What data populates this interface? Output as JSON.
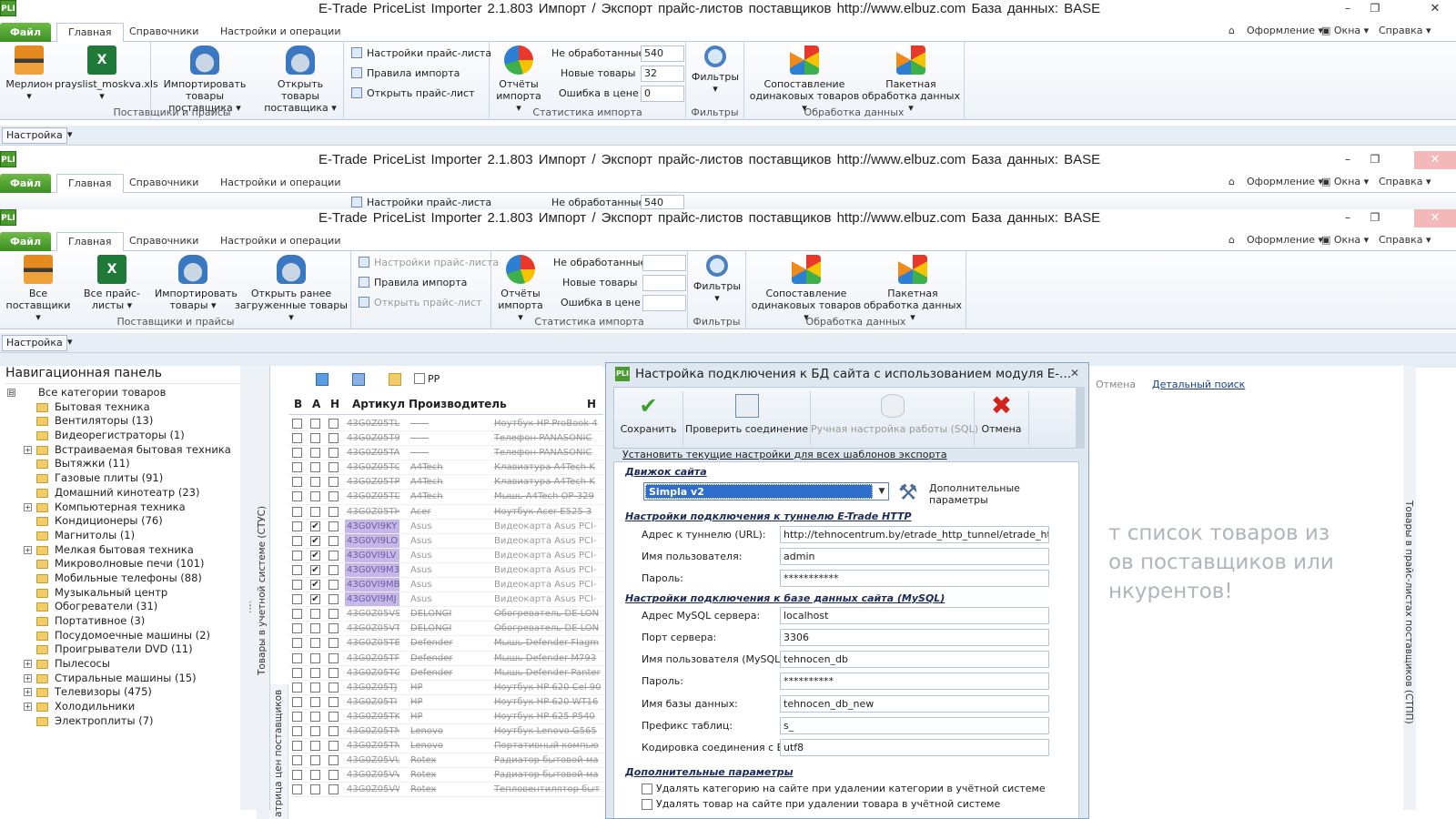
{
  "app": {
    "icon_label": "PLI",
    "title": "E-Trade PriceList Importer 2.1.803    Импорт / Экспорт прайс-листов поставщиков    http://www.elbuz.com    База данных: BASE",
    "minimize": "–",
    "restore": "❐",
    "close": "✕"
  },
  "tabs": {
    "file": "Файл",
    "home": "Главная",
    "refs": "Справочники",
    "settings_ops": "Настройки и операции",
    "appearance": "Оформление",
    "windows": "Окна",
    "help": "Справка"
  },
  "ribbon1": {
    "supplier_name": "Мерлион",
    "pricelist_file": "prayslist_moskva.xls",
    "import_goods": "Импортировать товары поставщика",
    "open_goods": "Открыть товары поставщика",
    "group_suppliers": "Поставщики и прайсы",
    "pl_settings": "Настройки прайс-листа",
    "import_rules": "Правила импорта",
    "open_pl": "Открыть прайс-лист",
    "reports": "Отчёты импорта",
    "not_processed": "Не обработанные",
    "new_goods": "Новые товары",
    "price_error": "Ошибка в цене",
    "not_processed_val": "540",
    "new_goods_val": "32",
    "price_error_val": "0",
    "group_stats": "Статистика импорта",
    "filters": "Фильтры",
    "group_filters": "Фильтры",
    "match": "Сопоставление одинаковых товаров",
    "batch": "Пакетная обработка данных",
    "group_data": "Обработка данных"
  },
  "ribbon3": {
    "all_suppliers": "Все поставщики",
    "all_pricelists": "Все прайс-листы",
    "import_goods": "Импортировать товары",
    "open_loaded": "Открыть ранее загруженные товары"
  },
  "quickbar": {
    "settings": "Настройка"
  },
  "nav": {
    "title": "Навигационная панель",
    "items": [
      {
        "label": "Все категории товаров",
        "exp": "⊟",
        "root": true
      },
      {
        "label": "Бытовая техника",
        "exp": ""
      },
      {
        "label": "Вентиляторы (13)",
        "exp": ""
      },
      {
        "label": "Видеорегистраторы (1)",
        "exp": ""
      },
      {
        "label": "Встраиваемая бытовая техника",
        "exp": "+"
      },
      {
        "label": "Вытяжки (11)",
        "exp": ""
      },
      {
        "label": "Газовые плиты (91)",
        "exp": ""
      },
      {
        "label": "Домашний кинотеатр (23)",
        "exp": ""
      },
      {
        "label": "Компьютерная техника",
        "exp": "+"
      },
      {
        "label": "Кондиционеры (76)",
        "exp": ""
      },
      {
        "label": "Магнитолы (1)",
        "exp": ""
      },
      {
        "label": "Мелкая бытовая техника",
        "exp": "+"
      },
      {
        "label": "Микроволновые печи (101)",
        "exp": ""
      },
      {
        "label": "Мобильные телефоны (88)",
        "exp": ""
      },
      {
        "label": "Музыкальный центр",
        "exp": ""
      },
      {
        "label": "Обогреватели (31)",
        "exp": ""
      },
      {
        "label": "Портативное (3)",
        "exp": ""
      },
      {
        "label": "Посудомоечные машины (2)",
        "exp": ""
      },
      {
        "label": "Проигрыватели DVD (11)",
        "exp": ""
      },
      {
        "label": "Пылесосы",
        "exp": "+"
      },
      {
        "label": "Стиральные машины (15)",
        "exp": "+"
      },
      {
        "label": "Телевизоры (475)",
        "exp": "+"
      },
      {
        "label": "Холодильники",
        "exp": "+"
      },
      {
        "label": "Электроплиты (7)",
        "exp": ""
      }
    ]
  },
  "grid": {
    "pp_label": "PP",
    "col_b": "В",
    "col_a": "А",
    "col_n": "Н",
    "col_article": "Артикул",
    "col_maker": "Производитель",
    "col_more": "Н",
    "side_label_1": "Товары в учетной системе (СТУС)",
    "side_label_2": "атрица цен поставщиков",
    "rows": [
      {
        "art": "43G0Z05TL",
        "man": "——",
        "name": "Ноутбук HP ProBook 4",
        "a": false,
        "hl": false
      },
      {
        "art": "43G0Z05T9",
        "man": "——",
        "name": "Телефон PANASONIC",
        "a": false,
        "hl": false
      },
      {
        "art": "43G0Z05TA",
        "man": "——",
        "name": "Телефон PANASONIC",
        "a": false,
        "hl": false
      },
      {
        "art": "43G0Z05TO",
        "man": "A4Tech",
        "name": "Клавиатура A4Tech K",
        "a": false,
        "hl": false
      },
      {
        "art": "43G0Z05TP",
        "man": "A4Tech",
        "name": "Клавиатура A4Tech K",
        "a": false,
        "hl": false
      },
      {
        "art": "43G0Z05TD",
        "man": "A4Tech",
        "name": "Мышь A4Tech OP-329",
        "a": false,
        "hl": false
      },
      {
        "art": "43G0Z05TH",
        "man": "Acer",
        "name": "Ноутбук Acer E525 3",
        "a": false,
        "hl": false
      },
      {
        "art": "43G0VI9KY",
        "man": "Asus",
        "name": "Видеокарта Asus PCI-",
        "a": true,
        "hl": true
      },
      {
        "art": "43G0VI9LO",
        "man": "Asus",
        "name": "Видеокарта Asus PCI-",
        "a": true,
        "hl": true
      },
      {
        "art": "43G0VI9LV",
        "man": "Asus",
        "name": "Видеокарта Asus PCI-",
        "a": true,
        "hl": true
      },
      {
        "art": "43G0VI9M3",
        "man": "Asus",
        "name": "Видеокарта Asus PCI-",
        "a": true,
        "hl": true
      },
      {
        "art": "43G0VI9MB",
        "man": "Asus",
        "name": "Видеокарта Asus PCI-",
        "a": true,
        "hl": true
      },
      {
        "art": "43G0VI9MJ",
        "man": "Asus",
        "name": "Видеокарта Asus PCI-",
        "a": true,
        "hl": true
      },
      {
        "art": "43G0Z05VS",
        "man": "DELONGI",
        "name": "Обогреватель DE LON",
        "a": false,
        "hl": false
      },
      {
        "art": "43G0Z05VT",
        "man": "DELONGI",
        "name": "Обогреватель DE LON",
        "a": false,
        "hl": false
      },
      {
        "art": "43G0Z05TE",
        "man": "Defender",
        "name": "Мышь Defender Flagm",
        "a": false,
        "hl": false
      },
      {
        "art": "43G0Z05TF",
        "man": "Defender",
        "name": "Мышь Defender M793",
        "a": false,
        "hl": false
      },
      {
        "art": "43G0Z05TG",
        "man": "Defender",
        "name": "Мышь Defender Panter",
        "a": false,
        "hl": false
      },
      {
        "art": "43G0Z05TJ",
        "man": "HP",
        "name": "Ноутбук HP 620 Cel 90",
        "a": false,
        "hl": false
      },
      {
        "art": "43G0Z05TI",
        "man": "HP",
        "name": "Ноутбук HP 620 WT16",
        "a": false,
        "hl": false
      },
      {
        "art": "43G0Z05TK",
        "man": "HP",
        "name": "Ноутбук HP 625 P540",
        "a": false,
        "hl": false
      },
      {
        "art": "43G0Z05TM",
        "man": "Lenovo",
        "name": "Ноутбук Lenovo G565",
        "a": false,
        "hl": false
      },
      {
        "art": "43G0Z05TN",
        "man": "Lenovo",
        "name": "Портативный компью",
        "a": false,
        "hl": false
      },
      {
        "art": "43G0Z05VU",
        "man": "Rotex",
        "name": "Радиатор бытовой ма",
        "a": false,
        "hl": false
      },
      {
        "art": "43G0Z05VV",
        "man": "Rotex",
        "name": "Радиатор бытовой ма",
        "a": false,
        "hl": false
      },
      {
        "art": "43G0Z05VW",
        "man": "Rotex",
        "name": "Тепловентилятор быт",
        "a": false,
        "hl": false
      }
    ]
  },
  "right": {
    "cancel": "Отмена",
    "detail_search": "Детальный поиск",
    "message": "т список товаров из\nов поставщиков или\nнкурентов!",
    "side_label": "Товары в прайс-листах поставщиков (СТПП)"
  },
  "dialog": {
    "title": "Настройка подключения к БД сайта с использованием модуля E-...",
    "close": "✕",
    "save": "Сохранить",
    "check": "Проверить соединение",
    "manual_sql": "Ручная настройка работы (SQL)",
    "cancel": "Отмена",
    "apply_all": "Установить текущие настройки для всех шаблонов экспорта",
    "engine_section": "Движок сайта",
    "engine_value": "Simpla v2",
    "extra_params": "Дополнительные параметры",
    "tunnel_section": "Настройки подключения к туннелю E-Trade HTTP",
    "tunnel_url_label": "Адрес к туннелю (URL):",
    "tunnel_url": "http://tehnocentrum.by/etrade_http_tunnel/etrade_http_tur",
    "user_label": "Имя пользователя:",
    "user": "admin",
    "pass_label": "Пароль:",
    "pass": "***********",
    "db_section": "Настройки подключения к базе данных сайта (MySQL)",
    "mysql_host_label": "Адрес MySQL сервера:",
    "mysql_host": "localhost",
    "port_label": "Порт сервера:",
    "port": "3306",
    "mysql_user_label": "Имя пользователя (MySQL):",
    "mysql_user": "tehnocen_db",
    "mysql_pass_label": "Пароль:",
    "mysql_pass": "**********",
    "dbname_label": "Имя базы данных:",
    "dbname": "tehnocen_db_new",
    "prefix_label": "Префикс таблиц:",
    "prefix": "s_",
    "encoding_label": "Кодировка соединения с БД:",
    "encoding": "utf8",
    "extra_section": "Дополнительные параметры",
    "opt1": "Удалять категорию на сайте при удалении категории в учётной системе",
    "opt2": "Удалять товар на сайте при удалении товара в учётной системе"
  }
}
